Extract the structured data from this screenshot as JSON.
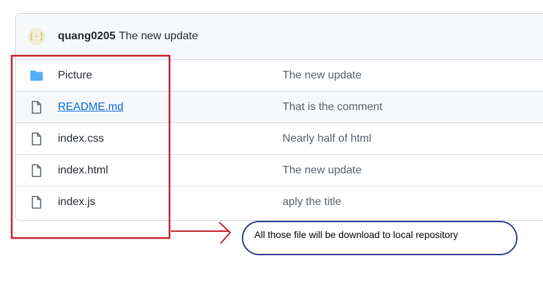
{
  "commit_header": {
    "author": "quang0205",
    "message": "The new update"
  },
  "files": [
    {
      "name": "Picture",
      "commit": "The new update",
      "icon": "folder-icon"
    },
    {
      "name": "README.md",
      "commit": "That is the comment",
      "icon": "file-icon"
    },
    {
      "name": "index.css",
      "commit": "Nearly half of html",
      "icon": "file-icon"
    },
    {
      "name": "index.html",
      "commit": "The new update",
      "icon": "file-icon"
    },
    {
      "name": "index.js",
      "commit": "aply the title",
      "icon": "file-icon"
    }
  ],
  "annotation": {
    "note": "All those file will be download to local repository",
    "box_color": "#c41f2b",
    "ellipse_color": "#2e3a8c"
  },
  "colors": {
    "folder": "#54aeff",
    "link": "#0969da",
    "header_bg": "#f6f8fa"
  }
}
